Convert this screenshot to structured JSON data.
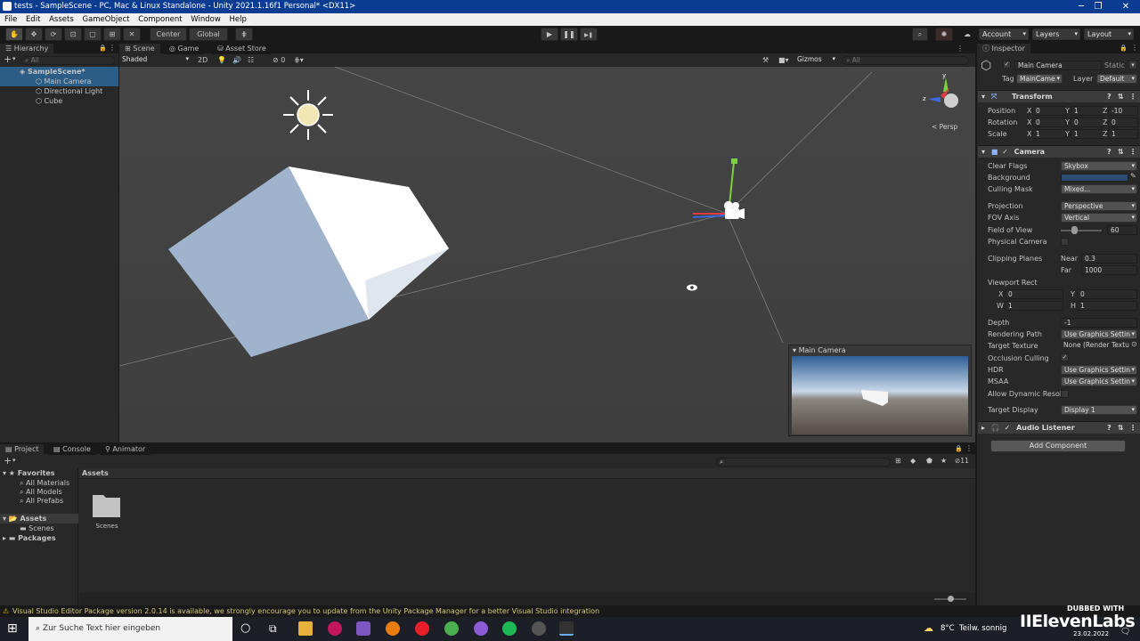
{
  "window": {
    "title": "tests - SampleScene - PC, Mac & Linux Standalone - Unity 2021.1.16f1 Personal* <DX11>",
    "minimize": "─",
    "maximize": "❐",
    "close": "✕"
  },
  "menu": [
    "File",
    "Edit",
    "Assets",
    "GameObject",
    "Component",
    "Window",
    "Help"
  ],
  "toolbar": {
    "pivot": "Center",
    "space": "Global",
    "account": "Account",
    "layers": "Layers",
    "layout": "Layout",
    "play": "▶",
    "pause": "❚❚",
    "step": "▶❚"
  },
  "hierarchy": {
    "tab": "Hierarchy",
    "search_placeholder": "All",
    "items": [
      {
        "label": "SampleScene*"
      },
      {
        "label": "Main Camera"
      },
      {
        "label": "Directional Light"
      },
      {
        "label": "Cube"
      }
    ]
  },
  "scene": {
    "tabs": [
      "Scene",
      "Game",
      "Asset Store"
    ],
    "shading": "Shaded",
    "mode2d": "2D",
    "hidden_count": "0",
    "gizmos": "Gizmos",
    "search_placeholder": "All",
    "persp": "< Persp",
    "overlay_title": "Main Camera"
  },
  "inspector": {
    "tab": "Inspector",
    "object_name": "Main Camera",
    "static": "Static",
    "tag_label": "Tag",
    "tag": "MainCame",
    "layer_label": "Layer",
    "layer": "Default",
    "transform": {
      "title": "Transform",
      "rows": [
        {
          "label": "Position",
          "x": "0",
          "y": "1",
          "z": "-10"
        },
        {
          "label": "Rotation",
          "x": "0",
          "y": "0",
          "z": "0"
        },
        {
          "label": "Scale",
          "x": "1",
          "y": "1",
          "z": "1"
        }
      ]
    },
    "camera": {
      "title": "Camera",
      "clear_flags_label": "Clear Flags",
      "clear_flags": "Skybox",
      "background_label": "Background",
      "culling_mask_label": "Culling Mask",
      "culling_mask": "Mixed...",
      "projection_label": "Projection",
      "projection": "Perspective",
      "fov_axis_label": "FOV Axis",
      "fov_axis": "Vertical",
      "fov_label": "Field of View",
      "fov": "60",
      "fov_fraction": 0.33,
      "physical_label": "Physical Camera",
      "clipping_label": "Clipping Planes",
      "near_label": "Near",
      "near": "0.3",
      "far_label": "Far",
      "far": "1000",
      "viewport_label": "Viewport Rect",
      "vx_label": "X",
      "vx": "0",
      "vy_label": "Y",
      "vy": "0",
      "vw_label": "W",
      "vw": "1",
      "vh_label": "H",
      "vh": "1",
      "depth_label": "Depth",
      "depth": "-1",
      "rendering_label": "Rendering Path",
      "rendering": "Use Graphics Settin",
      "target_texture_label": "Target Texture",
      "target_texture": "None (Render Textu",
      "occlusion_label": "Occlusion Culling",
      "occlusion_check": "✓",
      "hdr_label": "HDR",
      "hdr": "Use Graphics Settin",
      "msaa_label": "MSAA",
      "msaa": "Use Graphics Settin",
      "dynres_label": "Allow Dynamic Resol",
      "display_label": "Target Display",
      "display": "Display 1"
    },
    "audio_listener": {
      "title": "Audio Listener"
    },
    "add_component": "Add Component"
  },
  "project": {
    "tabs": [
      "Project",
      "Console",
      "Animator"
    ],
    "tree": [
      {
        "label": "Favorites"
      },
      {
        "label": "All Materials"
      },
      {
        "label": "All Models"
      },
      {
        "label": "All Prefabs"
      },
      {
        "label": "Assets"
      },
      {
        "label": "Scenes"
      },
      {
        "label": "Packages"
      }
    ],
    "breadcrumb": "Assets",
    "folder": "Scenes",
    "hidden_count": "11"
  },
  "status": {
    "message": "Visual Studio Editor Package version 2.0.14 is available, we strongly encourage you to update from the Unity Package Manager for a better Visual Studio integration"
  },
  "taskbar": {
    "search_placeholder": "Zur Suche Text hier eingeben",
    "weather": "8°C  Teilw. sonnig",
    "date": "23.02.2022",
    "watermark_line1": "DUBBED WITH",
    "watermark_line2": "IIElevenLabs"
  },
  "colors": {
    "accent": "#2c5d87",
    "title": "#0a3d91",
    "warning": "#e8b400"
  }
}
